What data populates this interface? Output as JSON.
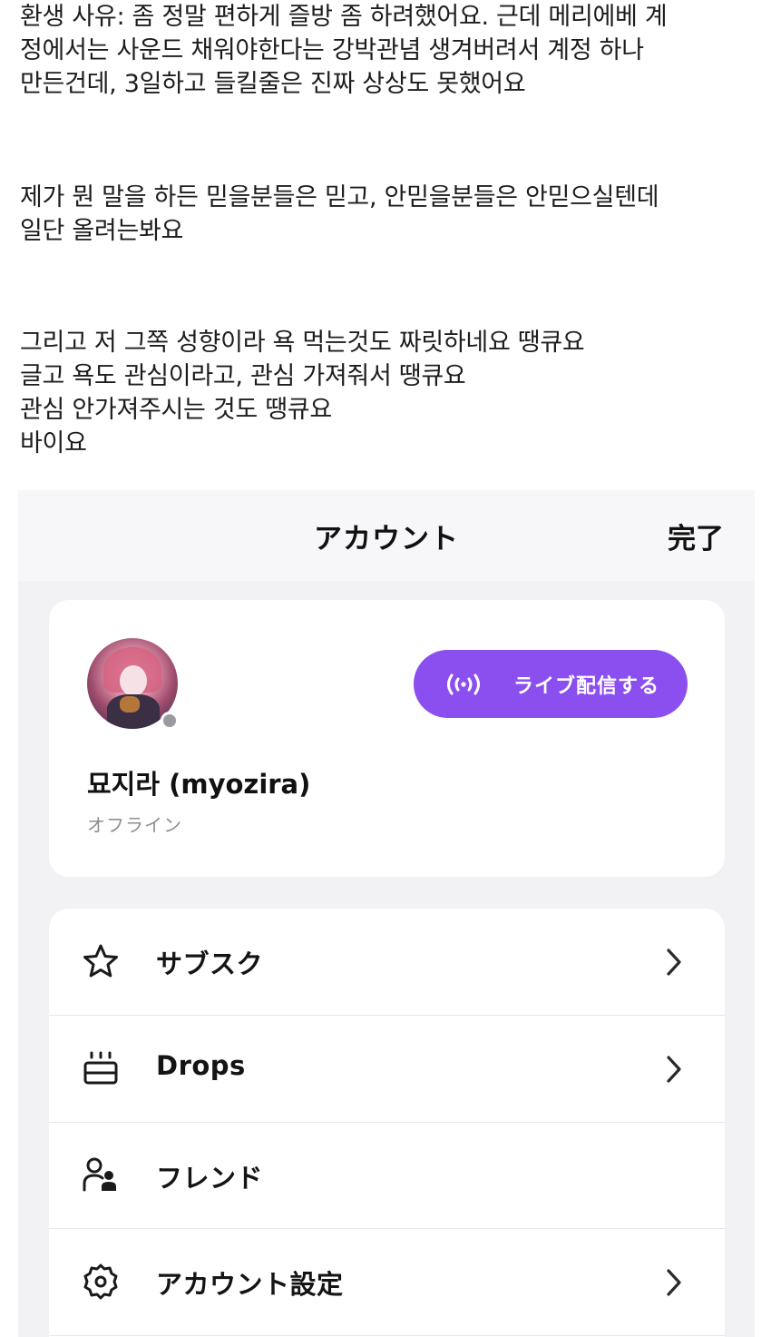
{
  "post": {
    "paragraph1": [
      "환생 사유: 좀 정말 편하게 즐방 좀 하려했어요. 근데 메리에베 계",
      "정에서는 사운드 채워야한다는 강박관념 생겨버려서 계정 하나",
      "만든건데, 3일하고 들킬줄은 진짜 상상도 못했어요"
    ],
    "paragraph2": [
      "제가 뭔 말을 하든 믿을분들은 믿고, 안믿을분들은 안믿으실텐데",
      "일단 올려는봐요"
    ],
    "paragraph3": [
      "그리고 저 그쪽 성향이라 욕 먹는것도 짜릿하네요 땡큐요",
      "글고 욕도 관심이라고, 관심 가져줘서 땡큐요",
      "관심 안가져주시는 것도 땡큐요",
      "바이요"
    ]
  },
  "screenshot": {
    "header": {
      "title": "アカウント",
      "done_label": "完了"
    },
    "profile": {
      "name": "묘지라 (myozira)",
      "status": "オフライン",
      "status_color": "#9a9a9f",
      "live_button_label": "ライブ配信する",
      "live_button_color": "#8b4ff0",
      "live_icon": "broadcast-icon"
    },
    "menu": {
      "items": [
        {
          "label": "サブスク",
          "icon": "star-icon",
          "has_chevron": true
        },
        {
          "label": "Drops",
          "icon": "gift-box-icon",
          "has_chevron": true
        },
        {
          "label": "フレンド",
          "icon": "friends-icon",
          "has_chevron": false
        },
        {
          "label": "アカウント設定",
          "icon": "gear-icon",
          "has_chevron": true
        }
      ]
    }
  }
}
